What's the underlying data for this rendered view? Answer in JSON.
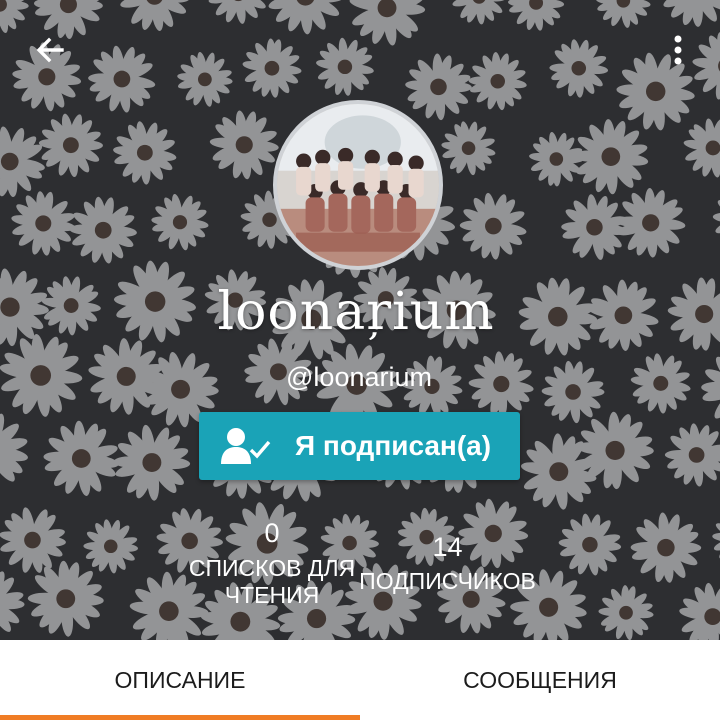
{
  "header": {
    "back_icon": "arrow-left-icon",
    "more_icon": "more-vertical-icon"
  },
  "profile": {
    "display_name": "loonaŗium",
    "username": "@loonarium",
    "follow_button_label": "Я подписан(а)",
    "follow_icon": "user-check-icon"
  },
  "stats": {
    "reading_lists": {
      "value": "0",
      "label_line1": "СПИСКОВ ДЛЯ",
      "label_line2": "ЧТЕНИЯ"
    },
    "followers": {
      "value": "14",
      "label": "ПОДПИСЧИКОВ"
    }
  },
  "tabs": [
    {
      "label": "ОПИСАНИЕ",
      "active": true
    },
    {
      "label": "СООБЩЕНИЯ",
      "active": false
    }
  ],
  "colors": {
    "accent": "#f07c24",
    "button": "#1aa3b7",
    "header_bg": "#3b3d40"
  }
}
